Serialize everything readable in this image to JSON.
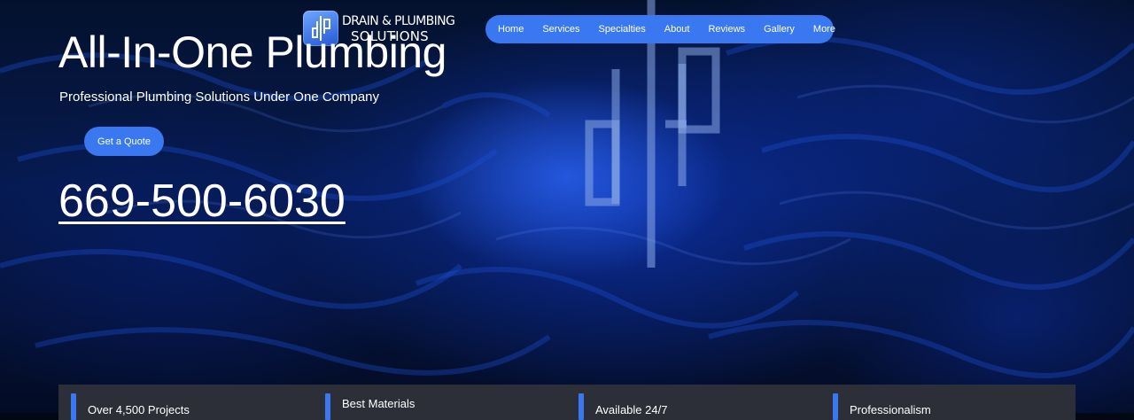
{
  "brand": {
    "logo_line1": "DRAIN & PLUMBING",
    "logo_line2": "SOLUTIONS",
    "logo_monogram": "dp",
    "accent_color": "#3a78f2"
  },
  "nav": {
    "items": [
      {
        "label": "Home"
      },
      {
        "label": "Services"
      },
      {
        "label": "Specialties"
      },
      {
        "label": "About"
      },
      {
        "label": "Reviews"
      },
      {
        "label": "Gallery"
      },
      {
        "label": "More"
      }
    ]
  },
  "hero": {
    "title": "All-In-One Plumbing",
    "subtitle": "Professional Plumbing Solutions Under One Company",
    "cta_label": "Get a Quote",
    "phone": "669-500-6030",
    "background": "blue rippling water"
  },
  "features": [
    {
      "label": "Over 4,500 Projects"
    },
    {
      "label": "Best Materials"
    },
    {
      "label": "Available 24/7"
    },
    {
      "label": "Professionalism"
    }
  ]
}
